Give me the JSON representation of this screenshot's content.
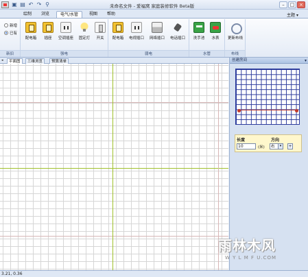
{
  "window": {
    "title": "未命名文件 - 爱福窝 家庭装修软件 Beta版",
    "minimize": "–",
    "maximize": "□",
    "close": "×"
  },
  "quick_access": [
    "save-icon",
    "print-icon",
    "undo-icon",
    "redo-icon",
    "preview-icon"
  ],
  "menu": {
    "tabs": [
      {
        "label": "绘制",
        "active": false
      },
      {
        "label": "浏览",
        "active": false
      },
      {
        "label": "电气/水管",
        "active": true
      },
      {
        "label": "视图",
        "active": false
      },
      {
        "label": "帮助",
        "active": false
      }
    ],
    "theme_label": "主题",
    "theme_arrow": "▾"
  },
  "ribbon": {
    "mode_group": {
      "label": "新旧",
      "options": [
        {
          "label": "新增",
          "selected": false
        },
        {
          "label": "已有",
          "selected": true
        }
      ]
    },
    "strong_group": {
      "label": "强电",
      "buttons": [
        {
          "label": "配电箱",
          "icon": "distribution-box-icon"
        },
        {
          "label": "插座",
          "icon": "socket-icon"
        },
        {
          "label": "空调插座",
          "icon": "ac-socket-icon"
        },
        {
          "label": "固定灯",
          "icon": "lamp-icon"
        },
        {
          "label": "开关",
          "icon": "switch-icon"
        }
      ]
    },
    "weak_group": {
      "label": "弱电",
      "buttons": [
        {
          "label": "配电箱",
          "icon": "distribution-box-icon"
        },
        {
          "label": "电视插口",
          "icon": "tv-socket-icon"
        },
        {
          "label": "网络插口",
          "icon": "network-socket-icon"
        },
        {
          "label": "电话插口",
          "icon": "phone-socket-icon"
        }
      ]
    },
    "water_group": {
      "label": "水管",
      "buttons": [
        {
          "label": "洗手池",
          "icon": "washbasin-icon"
        },
        {
          "label": "水表",
          "icon": "water-meter-icon"
        }
      ]
    },
    "wire_group": {
      "label": "布线",
      "buttons": [
        {
          "label": "更新布线",
          "icon": "update-wiring-icon"
        }
      ]
    }
  },
  "document_tabs": [
    {
      "label": "平面图",
      "active": true
    },
    {
      "label": "三维浏览",
      "active": false
    },
    {
      "label": "预算清单",
      "active": false
    }
  ],
  "canvas": {
    "axis_vertical_color": "#9fc02a",
    "axis_horizontal_color": "#d7b6b6",
    "grid_color": "#d6d6d6"
  },
  "side_panel": {
    "title": "创建房间",
    "arrow": "▾",
    "preview_grid_color": "#2c3b9c",
    "preview_line_color": "#c0392b",
    "length_label": "长度",
    "direction_label": "方向",
    "length_value": "10",
    "unit": "(米)",
    "direction_value": "右",
    "dropdown_arrow": "▾",
    "apply_label": "+"
  },
  "status": {
    "coords": "3.21, 0.36"
  },
  "watermark": {
    "name": "雨林木风",
    "url": "W Y L M F U.COM"
  }
}
